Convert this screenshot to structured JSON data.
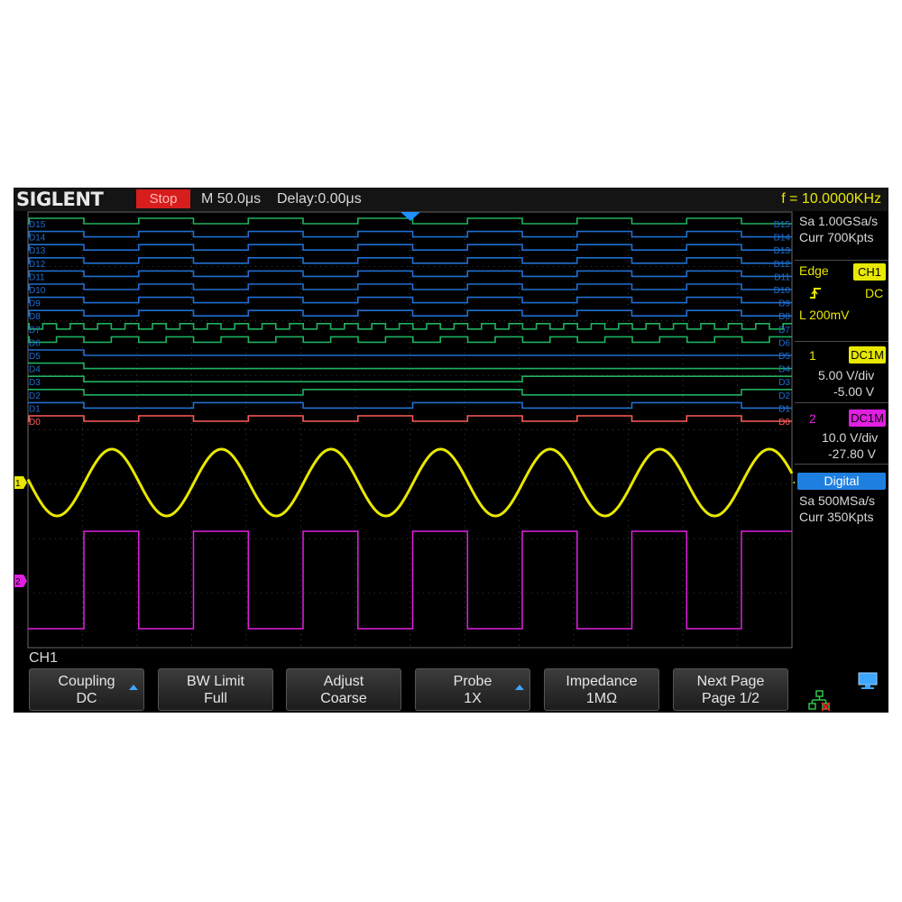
{
  "topbar": {
    "brand": "SIGLENT",
    "run_status": "Stop",
    "timebase": "M 50.0μs",
    "delay": "Delay:0.00μs",
    "frequency": "f = 10.0000KHz"
  },
  "acquisition": {
    "sample_rate": "Sa 1.00GSa/s",
    "memory": "Curr 700Kpts"
  },
  "trigger": {
    "type": "Edge",
    "source": "CH1",
    "coupling": "DC",
    "level": "L  200mV"
  },
  "channels": [
    {
      "number": "1",
      "coupling": "DC1M",
      "scale": "5.00 V/div",
      "offset": "-5.00 V",
      "color": "#e8e800"
    },
    {
      "number": "2",
      "coupling": "DC1M",
      "scale": "10.0 V/div",
      "offset": "-27.80 V",
      "color": "#e020e0"
    }
  ],
  "digital": {
    "title": "Digital",
    "sample_rate": "Sa 500MSa/s",
    "memory": "Curr 350Kpts"
  },
  "digital_lines": [
    "D15",
    "D14",
    "D13",
    "D12",
    "D11",
    "D10",
    "D9",
    "D8",
    "D7",
    "D6",
    "D5",
    "D4",
    "D3",
    "D2",
    "D1",
    "D0"
  ],
  "status_line": "CH1",
  "softkeys": [
    {
      "label": "Coupling",
      "value": "DC",
      "has_arrow": true
    },
    {
      "label": "BW Limit",
      "value": "Full",
      "has_arrow": false
    },
    {
      "label": "Adjust",
      "value": "Coarse",
      "has_arrow": false
    },
    {
      "label": "Probe",
      "value": "1X",
      "has_arrow": true
    },
    {
      "label": "Impedance",
      "value": "1MΩ",
      "has_arrow": false
    },
    {
      "label": "Next Page",
      "value": "Page 1/2",
      "has_arrow": false
    }
  ],
  "colors": {
    "ch1": "#e8e800",
    "ch2": "#e020e0",
    "digital_blue": "#1f6fd0",
    "digital_green": "#1fb060",
    "digital_red": "#ff5a5a",
    "run_stop": "#d81d1d",
    "accent": "#3ea6ff"
  },
  "icons": {
    "trigger_edge": "rising-edge-icon",
    "network": "network-disconnected-icon",
    "display": "monitor-icon"
  }
}
